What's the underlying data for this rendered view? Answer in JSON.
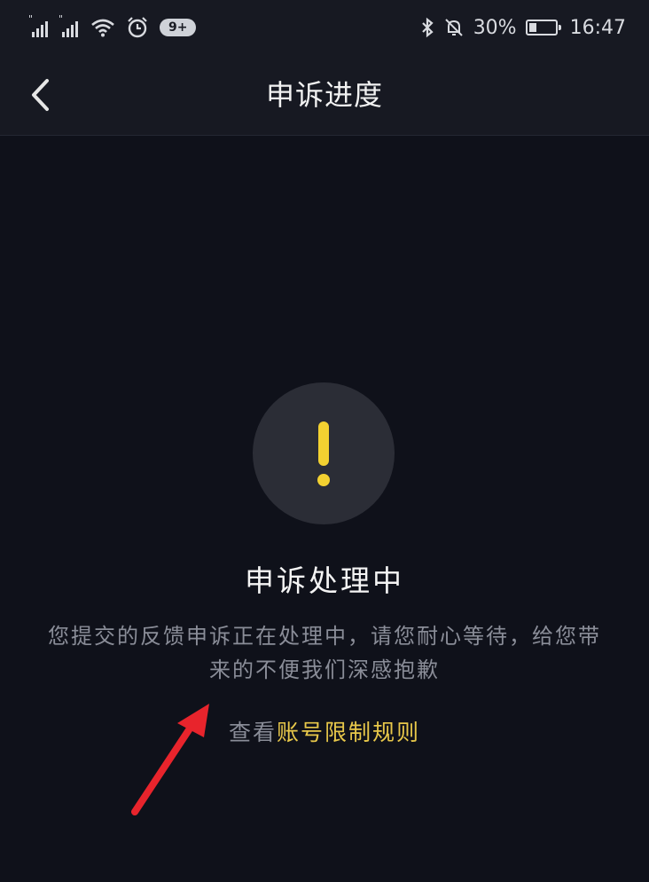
{
  "status_bar": {
    "signal1_label": "4G",
    "signal2_label": "4G",
    "badge": "9+",
    "battery": "30%",
    "battery_level": 0.3,
    "time": "16:47"
  },
  "header": {
    "title": "申诉进度"
  },
  "main": {
    "status_title": "申诉处理中",
    "description": "您提交的反馈申诉正在处理中，请您耐心等待，给您带来的不便我们深感抱歉",
    "link_prefix": "查看",
    "link_text": "账号限制规则",
    "warning_icon_color": "#f3d131",
    "link_color": "#e8c84a",
    "arrow_color": "#e8242c"
  },
  "icons": {
    "back": "chevron-left-icon",
    "warning": "exclamation-icon",
    "wifi": "wifi-icon",
    "alarm": "alarm-clock-icon",
    "bluetooth": "bluetooth-icon",
    "mute": "bell-off-icon",
    "battery": "battery-icon",
    "annotation": "red-arrow-annotation"
  }
}
